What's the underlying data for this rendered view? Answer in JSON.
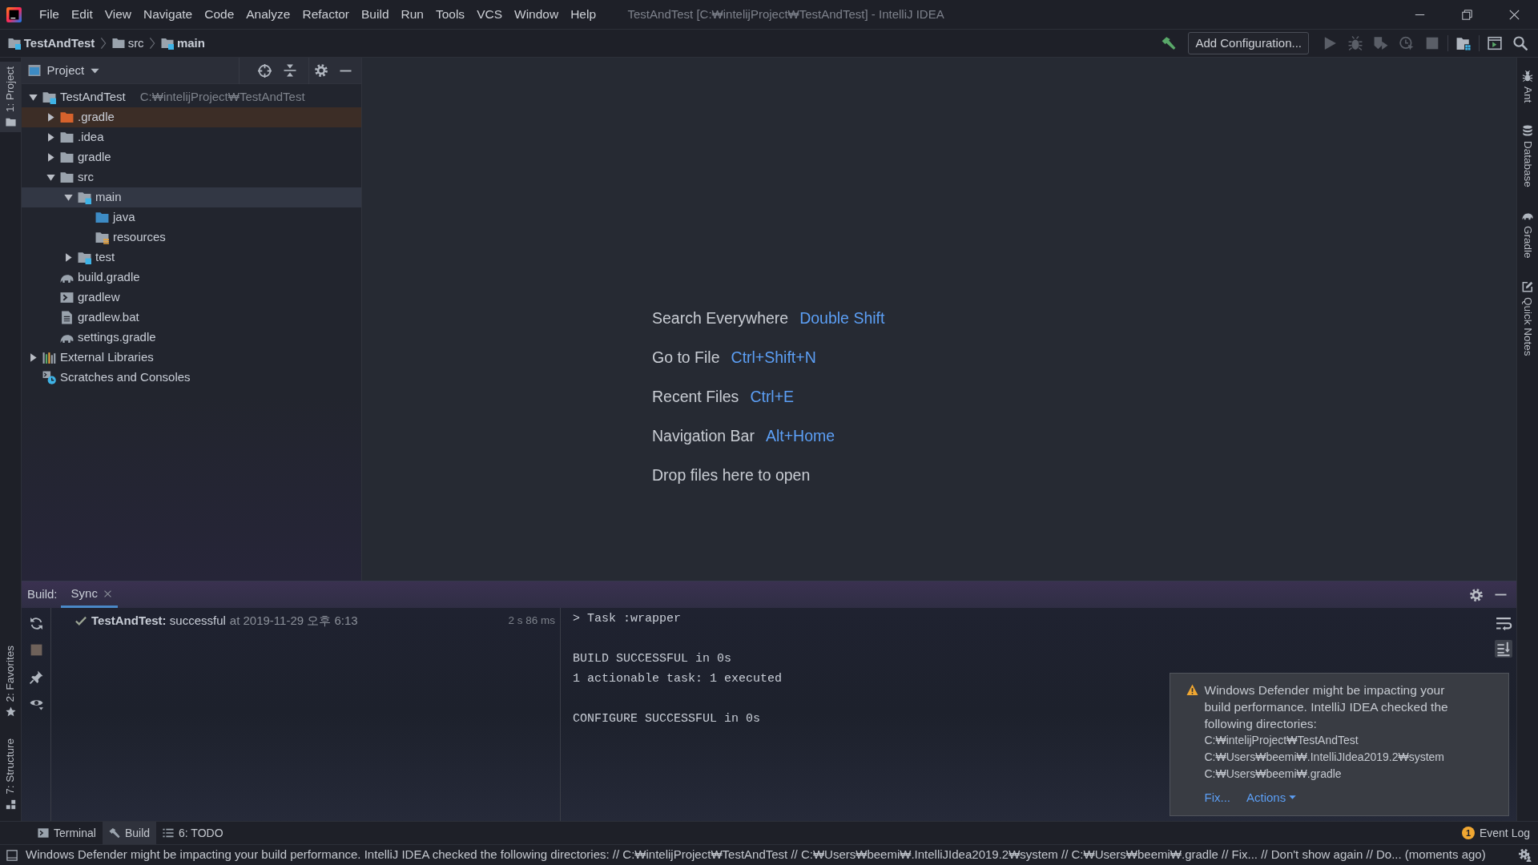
{
  "window": {
    "title": "TestAndTest [C:₩intelijProject₩TestAndTest] - IntelliJ IDEA"
  },
  "menu": [
    "File",
    "Edit",
    "View",
    "Navigate",
    "Code",
    "Analyze",
    "Refactor",
    "Build",
    "Run",
    "Tools",
    "VCS",
    "Window",
    "Help"
  ],
  "breadcrumbs": [
    {
      "label": "TestAndTest",
      "kind": "module"
    },
    {
      "label": "src",
      "kind": "folder"
    },
    {
      "label": "main",
      "kind": "module"
    }
  ],
  "toolbar": {
    "build_action": {
      "kind": "build",
      "disabled": false
    },
    "configuration": "Add Configuration...",
    "groups": [
      [
        {
          "kind": "run",
          "disabled": true
        },
        {
          "kind": "debug",
          "disabled": true
        },
        {
          "kind": "coverage",
          "disabled": true
        },
        {
          "kind": "profile",
          "disabled": true
        },
        {
          "kind": "stop",
          "disabled": true
        }
      ],
      [
        {
          "kind": "project-structure",
          "disabled": false
        }
      ],
      [
        {
          "kind": "run-window",
          "disabled": false
        },
        {
          "kind": "search",
          "disabled": false
        }
      ]
    ]
  },
  "left_strip": {
    "top": [
      {
        "label": "1: Project",
        "kind": "project",
        "selected": true
      }
    ],
    "bottom": [
      {
        "label": "2: Favorites",
        "kind": "favorites",
        "selected": false
      },
      {
        "label": "7: Structure",
        "kind": "structure",
        "selected": false
      }
    ]
  },
  "right_strip": [
    {
      "label": "Ant",
      "kind": "ant"
    },
    {
      "label": "Database",
      "kind": "database"
    },
    {
      "label": "Gradle",
      "kind": "gradle"
    },
    {
      "label": "Quick Notes",
      "kind": "notes"
    }
  ],
  "project": {
    "title": "Project",
    "tree": [
      {
        "label": "TestAndTest",
        "path": "C:₩intelijProject₩TestAndTest",
        "kind": "module",
        "expanded": true,
        "selected": false,
        "children": [
          {
            "label": ".gradle",
            "kind": "excluded-folder",
            "expanded": false,
            "selected": false
          },
          {
            "label": ".idea",
            "kind": "folder",
            "expanded": false,
            "selected": false
          },
          {
            "label": "gradle",
            "kind": "folder",
            "expanded": false,
            "selected": false
          },
          {
            "label": "src",
            "kind": "folder",
            "expanded": true,
            "selected": false,
            "children": [
              {
                "label": "main",
                "kind": "module",
                "expanded": true,
                "selected": true,
                "children": [
                  {
                    "label": "java",
                    "kind": "source-root",
                    "selected": false
                  },
                  {
                    "label": "resources",
                    "kind": "resources-root",
                    "selected": false
                  }
                ]
              },
              {
                "label": "test",
                "kind": "module",
                "expanded": false,
                "selected": false
              }
            ]
          },
          {
            "label": "build.gradle",
            "kind": "gradle-file",
            "selected": false
          },
          {
            "label": "gradlew",
            "kind": "script",
            "selected": false
          },
          {
            "label": "gradlew.bat",
            "kind": "text-file",
            "selected": false
          },
          {
            "label": "settings.gradle",
            "kind": "gradle-file",
            "selected": false
          }
        ]
      },
      {
        "label": "External Libraries",
        "kind": "libraries",
        "expanded": false,
        "selected": false
      },
      {
        "label": "Scratches and Consoles",
        "kind": "scratches",
        "selected": false
      }
    ]
  },
  "editor_hints": [
    {
      "label": "Search Everywhere",
      "shortcut": "Double Shift"
    },
    {
      "label": "Go to File",
      "shortcut": "Ctrl+Shift+N"
    },
    {
      "label": "Recent Files",
      "shortcut": "Ctrl+E"
    },
    {
      "label": "Navigation Bar",
      "shortcut": "Alt+Home"
    },
    {
      "label": "Drop files here to open"
    }
  ],
  "build": {
    "label": "Build:",
    "tabs": [
      {
        "label": "Sync",
        "selected": true
      }
    ],
    "tools": [
      {
        "kind": "sync",
        "disabled": false
      },
      {
        "kind": "stop",
        "disabled": true
      },
      {
        "kind": "pin",
        "disabled": false
      },
      {
        "kind": "view",
        "disabled": false
      }
    ],
    "results": [
      {
        "success": true,
        "title": "**TestAndTest:** successful",
        "time": "at 2019-11-29 오후 6:13",
        "duration": "2 s 86 ms"
      }
    ],
    "console": [
      [
        "> Task :wrapper"
      ],
      [
        "BUILD SUCCESSFUL in 0s",
        "1 actionable task: 1 executed"
      ],
      [
        "CONFIGURE SUCCESSFUL in 0s"
      ]
    ],
    "side_actions": [
      {
        "kind": "soft-wrap",
        "on": false
      },
      {
        "kind": "scroll-to-end",
        "on": true
      }
    ]
  },
  "notification": {
    "kind": "warning",
    "text": "Windows Defender might be impacting your build performance. IntelliJ IDEA checked the following directories:",
    "lines": [
      "C:₩intelijProject₩TestAndTest",
      "C:₩Users₩beemi₩.IntelliJIdea2019.2₩system",
      "C:₩Users₩beemi₩.gradle"
    ],
    "links": [
      {
        "label": "Fix...",
        "dropdown": false
      },
      {
        "label": "Actions",
        "dropdown": true
      }
    ]
  },
  "tool_windows": [
    {
      "label": "Terminal",
      "kind": "terminal",
      "selected": false
    },
    {
      "label": "Build",
      "kind": "build",
      "selected": true
    },
    {
      "label": "6: TODO",
      "kind": "todo",
      "selected": false
    }
  ],
  "event_log": {
    "label": "Event Log",
    "count": "1"
  },
  "status_bar": {
    "message": "Windows Defender might be impacting your build performance. IntelliJ IDEA checked the following directories: // C:₩intelijProject₩TestAndTest // C:₩Users₩beemi₩.IntelliJIdea2019.2₩system // C:₩Users₩beemi₩.gradle // Fix... // Don't show again // Do... (moments ago)"
  }
}
